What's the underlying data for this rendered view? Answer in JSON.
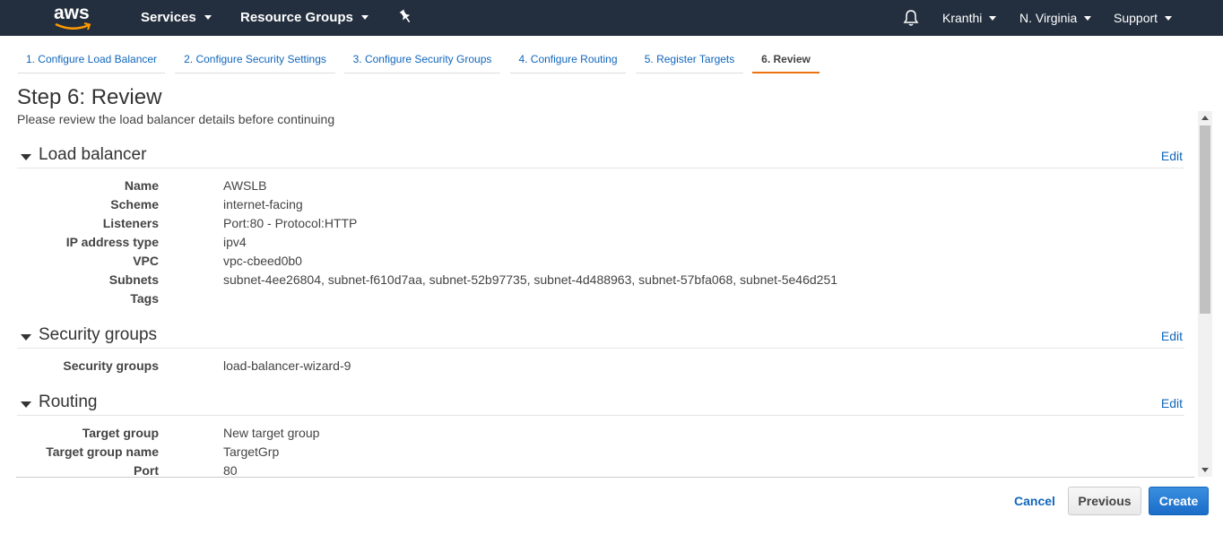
{
  "nav": {
    "logo": "aws",
    "services": "Services",
    "resource_groups": "Resource Groups",
    "user": "Kranthi",
    "region": "N. Virginia",
    "support": "Support"
  },
  "tabs": [
    {
      "label": "1. Configure Load Balancer"
    },
    {
      "label": "2. Configure Security Settings"
    },
    {
      "label": "3. Configure Security Groups"
    },
    {
      "label": "4. Configure Routing"
    },
    {
      "label": "5. Register Targets"
    },
    {
      "label": "6. Review"
    }
  ],
  "page": {
    "title": "Step 6: Review",
    "subtitle": "Please review the load balancer details before continuing"
  },
  "sections": {
    "load_balancer": {
      "title": "Load balancer",
      "edit": "Edit",
      "rows": [
        {
          "key": "Name",
          "value": "AWSLB"
        },
        {
          "key": "Scheme",
          "value": "internet-facing"
        },
        {
          "key": "Listeners",
          "value": "Port:80 - Protocol:HTTP"
        },
        {
          "key": "IP address type",
          "value": "ipv4"
        },
        {
          "key": "VPC",
          "value": "vpc-cbeed0b0"
        },
        {
          "key": "Subnets",
          "value": "subnet-4ee26804, subnet-f610d7aa, subnet-52b97735, subnet-4d488963, subnet-57bfa068, subnet-5e46d251"
        },
        {
          "key": "Tags",
          "value": ""
        }
      ]
    },
    "security_groups": {
      "title": "Security groups",
      "edit": "Edit",
      "rows": [
        {
          "key": "Security groups",
          "value": "load-balancer-wizard-9"
        }
      ]
    },
    "routing": {
      "title": "Routing",
      "edit": "Edit",
      "rows": [
        {
          "key": "Target group",
          "value": "New target group"
        },
        {
          "key": "Target group name",
          "value": "TargetGrp"
        },
        {
          "key": "Port",
          "value": "80"
        }
      ]
    }
  },
  "footer": {
    "cancel": "Cancel",
    "previous": "Previous",
    "create": "Create"
  },
  "colors": {
    "nav_bg": "#232f3e",
    "link": "#1166bb",
    "active_tab_underline": "#ec7211",
    "primary_button": "#1a6cc8"
  }
}
